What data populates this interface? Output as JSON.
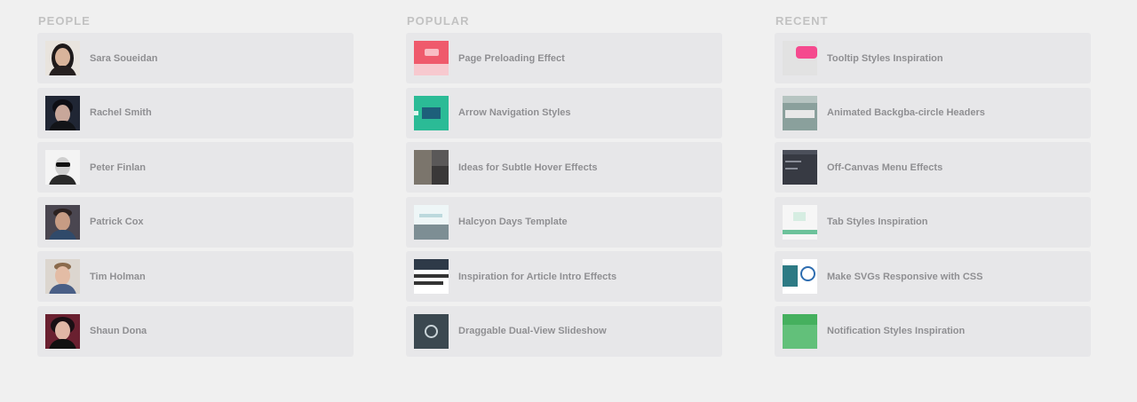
{
  "columns": {
    "people": {
      "title": "PEOPLE",
      "items": [
        {
          "label": "Sara Soueidan",
          "thumb": "avatar-sara"
        },
        {
          "label": "Rachel Smith",
          "thumb": "avatar-rachel"
        },
        {
          "label": "Peter Finlan",
          "thumb": "avatar-peter"
        },
        {
          "label": "Patrick Cox",
          "thumb": "avatar-patrick"
        },
        {
          "label": "Tim Holman",
          "thumb": "avatar-tim"
        },
        {
          "label": "Shaun Dona",
          "thumb": "avatar-shaun"
        }
      ]
    },
    "popular": {
      "title": "POPULAR",
      "items": [
        {
          "label": "Page Preloading Effect",
          "thumb": "preview-page-preloading"
        },
        {
          "label": "Arrow Navigation Styles",
          "thumb": "preview-arrow-navigation"
        },
        {
          "label": "Ideas for Subtle Hover Effects",
          "thumb": "preview-subtle-hover"
        },
        {
          "label": "Halcyon Days Template",
          "thumb": "preview-halcyon-days"
        },
        {
          "label": "Inspiration for Article Intro Effects",
          "thumb": "preview-article-intro"
        },
        {
          "label": "Draggable Dual-View Slideshow",
          "thumb": "preview-dual-view-slideshow"
        }
      ]
    },
    "recent": {
      "title": "RECENT",
      "items": [
        {
          "label": "Tooltip Styles Inspiration",
          "thumb": "preview-tooltip-styles"
        },
        {
          "label": "Animated Backgba-circle Headers",
          "thumb": "preview-animated-headers"
        },
        {
          "label": "Off-Canvas Menu Effects",
          "thumb": "preview-off-canvas-menu"
        },
        {
          "label": "Tab Styles Inspiration",
          "thumb": "preview-tab-styles"
        },
        {
          "label": "Make SVGs Responsive with CSS",
          "thumb": "preview-responsive-svgs"
        },
        {
          "label": "Notification Styles Inspiration",
          "thumb": "preview-notification-styles"
        }
      ]
    }
  },
  "colors": {
    "page_background": "#f0f0f0",
    "item_background": "#e7e7e9",
    "title_text": "#c2c2c2",
    "item_text": "#8f8f92"
  }
}
